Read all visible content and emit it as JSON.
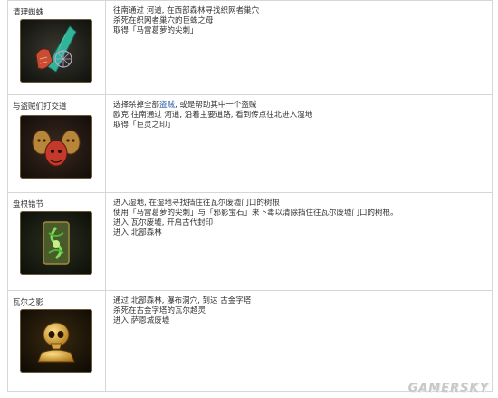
{
  "quests": [
    {
      "title": "清理蜘蛛",
      "icon": "spider-claw-icon",
      "lines": [
        "往南通过 河道, 在西部森林寻找织网者巢穴",
        "杀死在织网者巢穴的巨蛛之母",
        "取得「马雷葛萝的尖刺」"
      ]
    },
    {
      "title": "与盗贼们打交道",
      "icon": "bandit-masks-icon",
      "lines_pre": "选择杀掉全部",
      "lines_link": "盗贼",
      "lines_post": ", 或是帮助其中一个盗贼",
      "lines": [
        "欧克 往南通过 河道, 沿着主要道路, 看到传点往北进入湿地",
        "取得「巨灵之印」"
      ]
    },
    {
      "title": "盘根错节",
      "icon": "tangled-roots-icon",
      "lines": [
        "进入湿地, 在湿地寻找挡住往瓦尔废墟门口的树根",
        "使用「马雷葛萝的尖刺」与「邪影宝石」来下毒以清除挡住往瓦尔废墟门口的树根。",
        "进入 瓦尔废墟, 开启古代封印",
        "进入 北部森林"
      ]
    },
    {
      "title": "瓦尔之影",
      "icon": "skull-idol-icon",
      "lines": [
        "通过 北部森林, 瀑布洞穴, 到达 古金字塔",
        "杀死在古金字塔的瓦尔超灵",
        "进入 萨恩城废墟"
      ]
    }
  ],
  "watermark": "GAMERSKY"
}
